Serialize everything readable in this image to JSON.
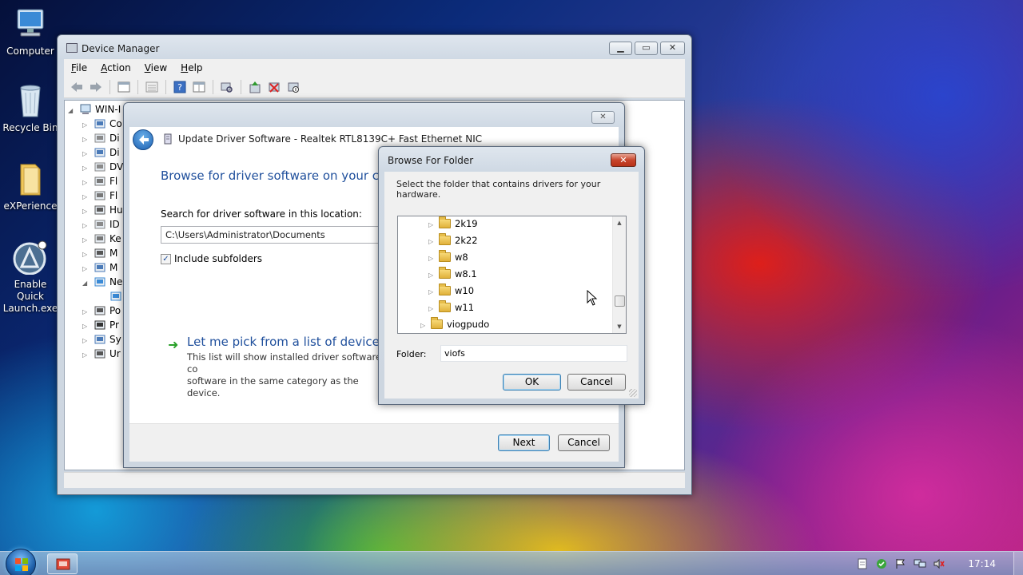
{
  "desktop": {
    "icons": [
      {
        "label": "Computer",
        "icon": "computer-icon"
      },
      {
        "label": "Recycle Bin",
        "icon": "recycle-bin-icon"
      },
      {
        "label": "eXPerience",
        "icon": "folder-icon"
      },
      {
        "label_line1": "Enable Quick",
        "label_line2": "Launch.exe",
        "icon": "quick-launch-icon"
      }
    ]
  },
  "device_manager": {
    "title": "Device Manager",
    "menu": {
      "file": "File",
      "action": "Action",
      "view": "View",
      "help": "Help"
    },
    "tree_root": "WIN-I",
    "tree_items": [
      "Co",
      "Di",
      "Di",
      "DV",
      "Fl",
      "Fl",
      "Hu",
      "ID",
      "Ke",
      "M",
      "M",
      "Ne",
      "",
      "Po",
      "Pr",
      "Sy",
      "Ur"
    ]
  },
  "update_driver": {
    "title": "Update Driver Software - Realtek RTL8139C+ Fast Ethernet NIC",
    "heading": "Browse for driver software on your com",
    "search_label": "Search for driver software in this location:",
    "path_value": "C:\\Users\\Administrator\\Documents",
    "include_subfolders": "Include subfolders",
    "include_checked": true,
    "pick_link": "Let me pick from a list of device dr",
    "pick_desc_line1": "This list will show installed driver software co",
    "pick_desc_line2": "software in the same category as the device.",
    "next_label": "Next",
    "cancel_label": "Cancel"
  },
  "browse_folder": {
    "title": "Browse For Folder",
    "description": "Select the folder that contains drivers for your hardware.",
    "folders": [
      {
        "name": "2k19",
        "level": 2
      },
      {
        "name": "2k22",
        "level": 2
      },
      {
        "name": "w8",
        "level": 2
      },
      {
        "name": "w8.1",
        "level": 2
      },
      {
        "name": "w10",
        "level": 2
      },
      {
        "name": "w11",
        "level": 2
      },
      {
        "name": "viogpudo",
        "level": 1
      }
    ],
    "folder_label": "Folder:",
    "folder_value": "viofs",
    "ok_label": "OK",
    "cancel_label": "Cancel"
  },
  "taskbar": {
    "clock": "17:14",
    "tray_icons": [
      "file-icon",
      "shield-check-icon",
      "flag-icon",
      "network-icon",
      "volume-muted-icon"
    ]
  },
  "colors": {
    "link_blue": "#1f4f9c",
    "close_red": "#c7452c"
  }
}
